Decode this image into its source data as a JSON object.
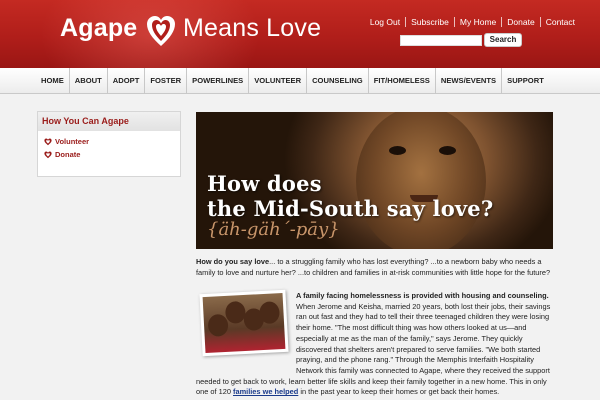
{
  "brand": {
    "name_left": "Agape",
    "name_right": "Means Love",
    "logo_icon": "heart-logo-icon",
    "colors": {
      "header_red": "#b01e1a",
      "accent_red": "#9a1c1a",
      "link_blue": "#1a3a8a"
    }
  },
  "top_links": [
    "Log Out",
    "Subscribe",
    "My Home",
    "Donate",
    "Contact"
  ],
  "search": {
    "placeholder": "",
    "button_label": "Search"
  },
  "nav": [
    "HOME",
    "ABOUT",
    "ADOPT",
    "FOSTER",
    "POWERLINES",
    "VOLUNTEER",
    "COUNSELING",
    "FIT/HOMELESS",
    "NEWS/EVENTS",
    "SUPPORT"
  ],
  "sidebar": {
    "title": "How You Can Agape",
    "items": [
      {
        "label": "Volunteer",
        "icon": "heart-bullet-icon"
      },
      {
        "label": "Donate",
        "icon": "heart-bullet-icon"
      }
    ]
  },
  "hero": {
    "line1": "How does",
    "line2": "the Mid-South say love?",
    "phonetic": "{äh-gäh´-pāy}"
  },
  "intro": {
    "lead": "How do you say love",
    "text": "... to a struggling family who has lost everything? ...to a newborn baby who needs a family to love and nurture her? ...to children and families in at-risk communities with little hope for the future?"
  },
  "story": {
    "headline": "A family facing homelessness is provided with housing and counseling.",
    "body": "When Jerome and Keisha, married 20 years, both lost their jobs, their savings ran out fast and they had to tell their three teenaged children they were losing their home. \"The most difficult thing was how others looked at us—and especially at me as the man of the family,\" says Jerome. They quickly discovered that shelters aren't prepared to serve families. \"We both started praying, and the phone rang.\" Through the Memphis Interfaith Hospitality Network this family was connected to Agape, where they received the support needed to get back to work, learn better life skills and keep their family together in a new home. This in only one of 120",
    "link_text": "families we helped",
    "tail": " in the past year to keep their homes or get back their homes."
  }
}
